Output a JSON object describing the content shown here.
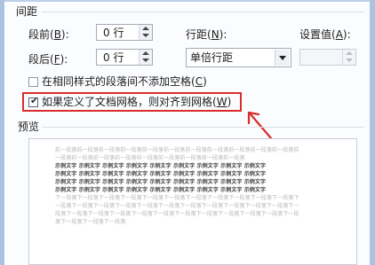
{
  "section": {
    "spacing_title": "间距",
    "preview_title": "预览"
  },
  "spacing": {
    "before": {
      "label_pre": "段前(",
      "label_key": "B",
      "label_post": "):",
      "value": "0 行"
    },
    "after": {
      "label_pre": "段后(",
      "label_key": "F",
      "label_post": "):",
      "value": "0 行"
    },
    "line_spacing": {
      "label_pre": "行距(",
      "label_key": "N",
      "label_post": "):",
      "value": "单倍行距"
    },
    "set_value": {
      "label_pre": "设置值(",
      "label_key": "A",
      "label_post": "):",
      "value": ""
    }
  },
  "checkboxes": {
    "no_space_same_style": {
      "label_pre": "在相同样式的段落间不添加空格(",
      "label_key": "C",
      "label_post": ")",
      "checked": false
    },
    "snap_to_grid": {
      "label_pre": "如果定义了文档网格，则对齐到网格(",
      "label_key": "W",
      "label_post": ")",
      "checked": true
    }
  },
  "preview": {
    "prev_lines": [
      "前一段落前一段落前一段落前一段落前一段落前一段落前一段落前一段落前一段落前一段落前一段落前",
      "一段落前一段落前一段落前一段落前一段落前一段落前一段落前一段落前一段落"
    ],
    "sample_lines": [
      "示例文字 示例文字 示例文字 示例文字 示例文字 示例文字 示例文字 示例文字 示例文字",
      "示例文字 示例文字 示例文字 示例文字 示例文字 示例文字 示例文字 示例文字 示例文字",
      "示例文字 示例文字 示例文字 示例文字 示例文字 示例文字 示例文字 示例文字 示例文字",
      "示例文字 示例文字 示例文字 示例文字 示例文字 示例文字 示例文字 示例文字 示例文字"
    ],
    "next_lines": [
      "下一段落下一段落下一段落下一段落下一段落下一段落下一段落下一段落下一段落下一段落下一段落下",
      "一段落下一段落下一段落下一段落下一段落下一段落下一段落下一段落下一段落下一段落下一段落下一",
      "段落下一段落下一段落下一段落下一段落下一段落下一段落下一段落下一段落下一段落下一段落下一段",
      "落下一段落下一段落下一段落"
    ]
  },
  "colors": {
    "highlight_border": "#d92c2c",
    "arrow": "#d92c2c",
    "frame": "#a9c3e1"
  }
}
